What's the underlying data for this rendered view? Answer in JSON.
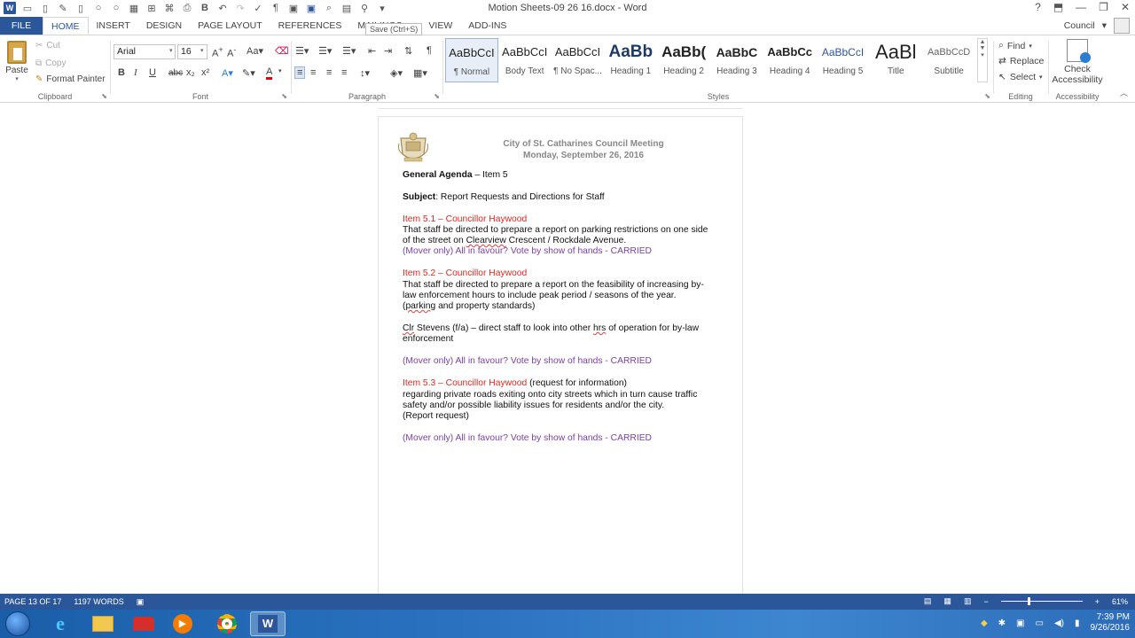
{
  "window": {
    "title": "Motion Sheets-09 26 16.docx - Word",
    "save_tooltip": "Save (Ctrl+S)",
    "help": "?",
    "account_name": "Council"
  },
  "tabs": [
    "FILE",
    "HOME",
    "INSERT",
    "DESIGN",
    "PAGE LAYOUT",
    "REFERENCES",
    "MAILINGS",
    "VIEW",
    "ADD-INS"
  ],
  "active_tab": "HOME",
  "clipboard": {
    "paste": "Paste",
    "cut": "Cut",
    "copy": "Copy",
    "format_painter": "Format Painter",
    "group": "Clipboard"
  },
  "font": {
    "name": "Arial",
    "size": "16",
    "bold": "B",
    "italic": "I",
    "underline": "U",
    "strike": "abc",
    "group": "Font"
  },
  "paragraph": {
    "group": "Paragraph"
  },
  "styles": {
    "group": "Styles",
    "items": [
      {
        "sample": "AaBbCcI",
        "name": "¶ Normal"
      },
      {
        "sample": "AaBbCcI",
        "name": "Body Text"
      },
      {
        "sample": "AaBbCcI",
        "name": "¶ No Spac..."
      },
      {
        "sample": "AaBb",
        "name": "Heading 1"
      },
      {
        "sample": "AaBb(",
        "name": "Heading 2"
      },
      {
        "sample": "AaBbC",
        "name": "Heading 3"
      },
      {
        "sample": "AaBbCc",
        "name": "Heading 4"
      },
      {
        "sample": "AaBbCcI",
        "name": "Heading 5"
      },
      {
        "sample": "AaBl",
        "name": "Title"
      },
      {
        "sample": "AaBbCcD",
        "name": "Subtitle"
      }
    ]
  },
  "editing": {
    "find": "Find",
    "replace": "Replace",
    "select": "Select",
    "group": "Editing"
  },
  "accessibility": {
    "button": "Check Accessibility",
    "group": "Accessibility"
  },
  "document": {
    "header_line1": "City of St. Catharines Council Meeting",
    "header_line2": "Monday, September 26, 2016",
    "agenda_bold": "General Agenda",
    "agenda_rest": " – Item 5",
    "subject_bold": "Subject",
    "subject_rest": ": Report Requests and Directions for Staff",
    "item1_title": "Item 5.1 – Councillor Haywood",
    "item1_l1": "That staff be directed to prepare a report on parking restrictions on one side",
    "item1_l2a": "of the street on ",
    "item1_l2b": "Clearview",
    "item1_l2c": " Crescent / Rockdale Avenue.",
    "item1_vote": "(Mover only)  All in favour?  Vote by show of hands - CARRIED",
    "item2_title": "Item 5.2 – Councillor Haywood",
    "item2_l1": "That staff be directed to prepare a report on the feasibility of increasing by-",
    "item2_l2": "law enforcement hours to include peak period / seasons of the year.",
    "item2_l3a": "(",
    "item2_l3b": "parking",
    "item2_l3c": " and property standards)",
    "clr_a": "Clr",
    "clr_b": " Stevens (f/a) – direct staff to look into other ",
    "clr_c": "hrs",
    "clr_d": " of operation for by-law",
    "clr_l2": "enforcement",
    "item2_vote": "(Mover only)  All in favour?  Vote by show of hands - CARRIED",
    "item3_title": "Item 5.3 – Councillor Haywood",
    "item3_title_rest": " (request for information)",
    "item3_l1": "   regarding private roads exiting onto city streets which in turn cause traffic",
    "item3_l2": "safety and/or possible liability issues for residents and/or the city.",
    "item3_l3": "(Report request)",
    "item3_vote": "(Mover only)  All in favour?  Vote by show of hands - CARRIED"
  },
  "status": {
    "page": "PAGE 13 OF 17",
    "words": "1197 WORDS",
    "zoom": "61%",
    "minus": "−",
    "plus": "+"
  },
  "taskbar": {
    "time": "7:39 PM",
    "date": "9/26/2016"
  },
  "colors": {
    "word_blue": "#2b579a",
    "item_red": "#e2261f",
    "vote_purple": "#7b3fa6"
  }
}
